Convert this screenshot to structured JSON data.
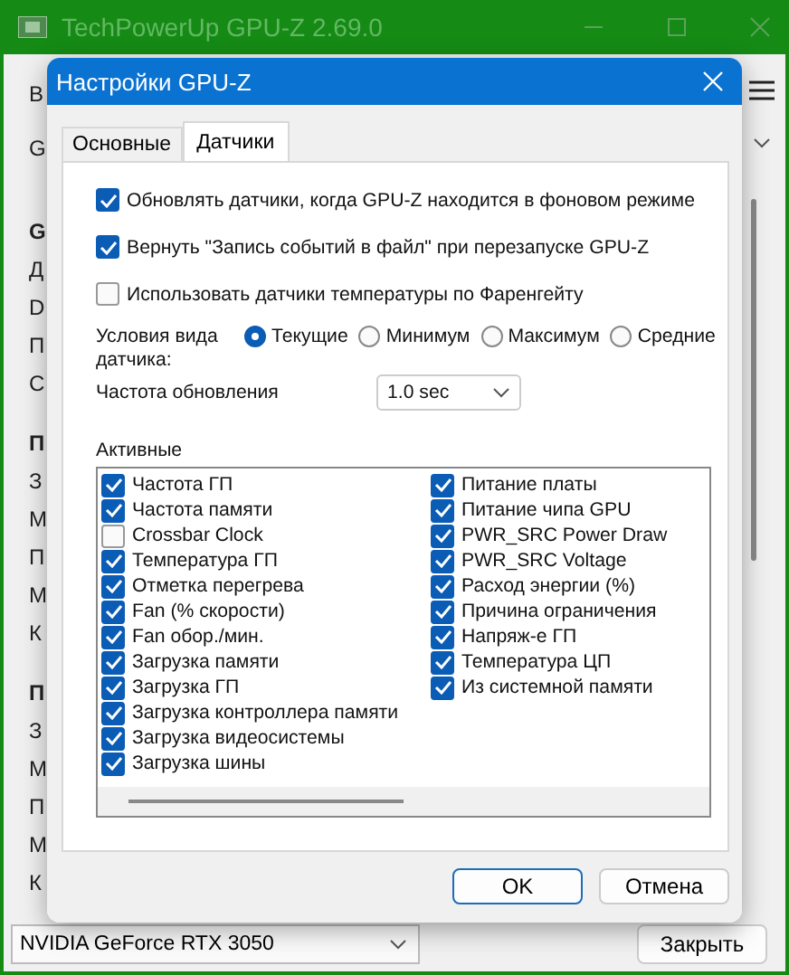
{
  "window": {
    "title": "TechPowerUp GPU-Z 2.69.0"
  },
  "background_strip": [
    {
      "text": "В",
      "kind": "tab"
    },
    {
      "text": "G",
      "kind": "field"
    },
    {
      "text": "G",
      "kind": "heading"
    },
    {
      "text": "Д",
      "kind": "row"
    },
    {
      "text": "D",
      "kind": "row"
    },
    {
      "text": "П",
      "kind": "row"
    },
    {
      "text": "С",
      "kind": "row"
    },
    {
      "text": "П",
      "kind": "heading"
    },
    {
      "text": "З",
      "kind": "row"
    },
    {
      "text": "М",
      "kind": "row"
    },
    {
      "text": "П",
      "kind": "row"
    },
    {
      "text": "М",
      "kind": "row"
    },
    {
      "text": "К",
      "kind": "row"
    },
    {
      "text": "П",
      "kind": "heading"
    },
    {
      "text": "З",
      "kind": "row"
    },
    {
      "text": "М",
      "kind": "row"
    },
    {
      "text": "П",
      "kind": "row"
    },
    {
      "text": "М",
      "kind": "row"
    },
    {
      "text": "К",
      "kind": "row"
    }
  ],
  "dialog": {
    "title": "Настройки GPU-Z",
    "tabs": [
      {
        "label": "Основные",
        "selected": false
      },
      {
        "label": "Датчики",
        "selected": true
      }
    ],
    "options": [
      {
        "label": "Обновлять датчики, когда GPU-Z находится в фоновом режиме",
        "checked": true
      },
      {
        "label": "Вернуть \"Запись событий в файл\" при перезапуске GPU-Z",
        "checked": true
      },
      {
        "label": "Использовать датчики температуры по Фаренгейту",
        "checked": false
      }
    ],
    "view_mode": {
      "label": "Условия вида датчика:",
      "options": [
        {
          "label": "Текущие",
          "selected": true
        },
        {
          "label": "Минимум",
          "selected": false
        },
        {
          "label": "Максимум",
          "selected": false
        },
        {
          "label": "Средние",
          "selected": false
        }
      ]
    },
    "refresh": {
      "label": "Частота обновления",
      "value": "1.0 sec"
    },
    "active": {
      "label": "Активные",
      "columns": [
        [
          {
            "label": "Частота ГП",
            "checked": true
          },
          {
            "label": "Частота памяти",
            "checked": true
          },
          {
            "label": "Crossbar Clock",
            "checked": false
          },
          {
            "label": "Температура ГП",
            "checked": true
          },
          {
            "label": "Отметка перегрева",
            "checked": true
          },
          {
            "label": "Fan (% скорости)",
            "checked": true
          },
          {
            "label": "Fan обор./мин.",
            "checked": true
          },
          {
            "label": "Загрузка памяти",
            "checked": true
          },
          {
            "label": "Загрузка ГП",
            "checked": true
          },
          {
            "label": "Загрузка контроллера памяти",
            "checked": true
          },
          {
            "label": "Загрузка видеосистемы",
            "checked": true
          },
          {
            "label": "Загрузка шины",
            "checked": true
          }
        ],
        [
          {
            "label": "Питание платы",
            "checked": true
          },
          {
            "label": "Питание чипа GPU",
            "checked": true
          },
          {
            "label": "PWR_SRC Power Draw",
            "checked": true
          },
          {
            "label": "PWR_SRC Voltage",
            "checked": true
          },
          {
            "label": "Расход энергии (%)",
            "checked": true
          },
          {
            "label": "Причина ограничения",
            "checked": true
          },
          {
            "label": "Напряж-е ГП",
            "checked": true
          },
          {
            "label": "Температура ЦП",
            "checked": true
          },
          {
            "label": "Из системной памяти",
            "checked": true
          }
        ]
      ]
    },
    "buttons": [
      {
        "label": "OK",
        "kind": "default"
      },
      {
        "label": "Отмена",
        "kind": "normal"
      }
    ]
  },
  "bottom": {
    "gpu": "NVIDIA GeForce RTX 3050",
    "close": "Закрыть"
  }
}
